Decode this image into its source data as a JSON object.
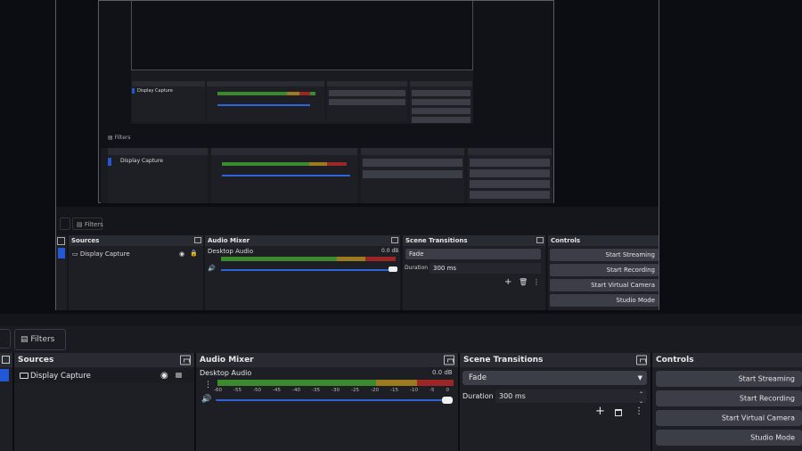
{
  "app": {
    "filters_tab": "Filters"
  },
  "docks": {
    "sources": {
      "title": "Sources",
      "items": [
        {
          "label": "Display Capture"
        }
      ]
    },
    "audio_mixer": {
      "title": "Audio Mixer",
      "channel": "Desktop Audio",
      "level": "0.0 dB",
      "ticks": [
        "-60",
        "-55",
        "-50",
        "-45",
        "-40",
        "-35",
        "-30",
        "-25",
        "-20",
        "-15",
        "-10",
        "-5",
        "0"
      ]
    },
    "scene_transitions": {
      "title": "Scene Transitions",
      "transition": "Fade",
      "duration_label": "Duration",
      "duration_value": "300 ms"
    },
    "controls": {
      "title": "Controls",
      "buttons": [
        "Start Streaming",
        "Start Recording",
        "Start Virtual Camera",
        "Studio Mode"
      ]
    }
  },
  "colors": {
    "accent": "#2257d6",
    "meter_green": "#3c8a2e",
    "meter_yellow": "#9b7b1e",
    "meter_red": "#9c2525",
    "dock_bg": "#1e1f25",
    "title_bg": "#292b33"
  }
}
